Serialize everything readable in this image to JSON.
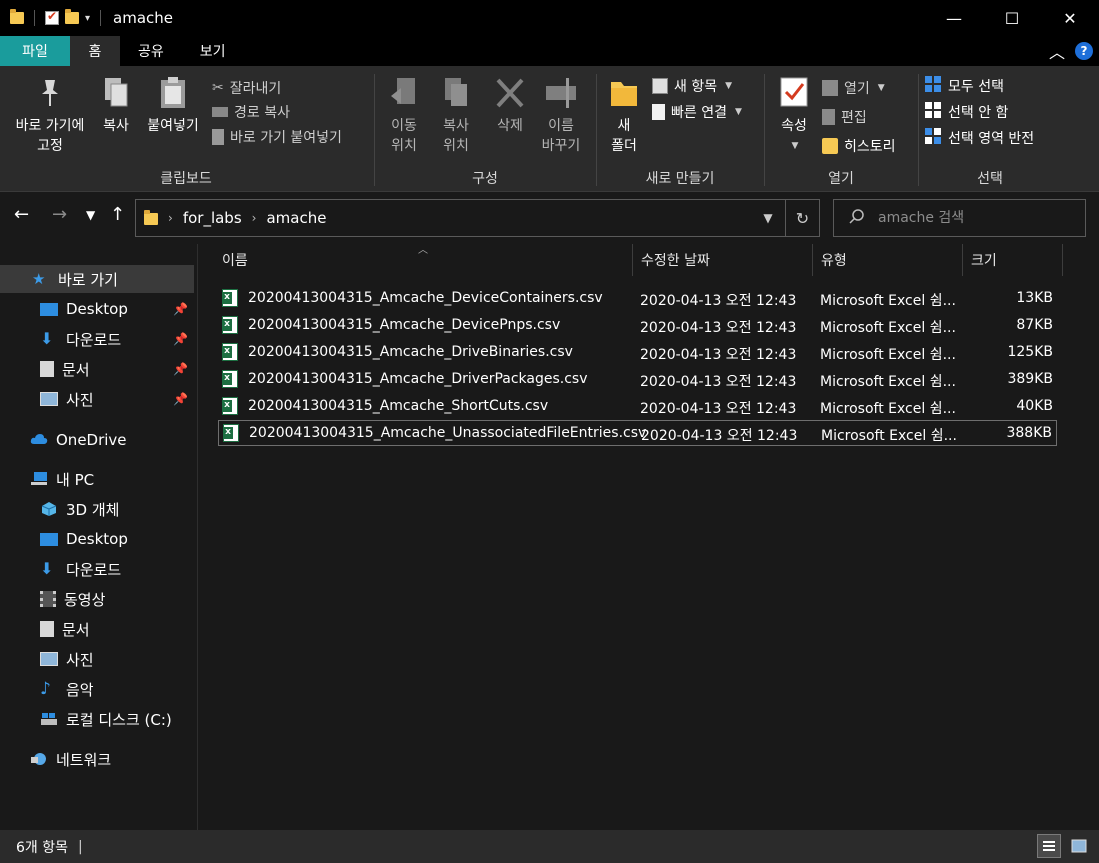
{
  "window": {
    "title": "amache",
    "minimize": "—",
    "maximize": "☐",
    "close": "✕"
  },
  "tabs": [
    "파일",
    "홈",
    "공유",
    "보기"
  ],
  "ribbon": {
    "clipboard": {
      "label": "클립보드",
      "pin_line1": "바로 가기에",
      "pin_line2": "고정",
      "copy": "복사",
      "paste": "붙여넣기",
      "cut": "잘라내기",
      "copy_path": "경로 복사",
      "paste_shortcut": "바로 가기 붙여넣기"
    },
    "organize": {
      "label": "구성",
      "move_line1": "이동",
      "move_line2": "위치",
      "copyto_line1": "복사",
      "copyto_line2": "위치",
      "delete": "삭제",
      "rename_line1": "이름",
      "rename_line2": "바꾸기"
    },
    "new": {
      "label": "새로 만들기",
      "folder_line1": "새",
      "folder_line2": "폴더",
      "new_item": "새 항목",
      "easy_access": "빠른 연결"
    },
    "open": {
      "label": "열기",
      "properties": "속성",
      "open": "열기",
      "edit": "편집",
      "history": "히스토리"
    },
    "select": {
      "label": "선택",
      "select_all": "모두 선택",
      "select_none": "선택 안 함",
      "invert": "선택 영역 반전"
    }
  },
  "address": {
    "path": [
      "for_labs",
      "amache"
    ],
    "search_placeholder": "amache 검색"
  },
  "sidebar": {
    "quick_access": "바로 가기",
    "pinned": [
      "Desktop",
      "다운로드",
      "문서",
      "사진"
    ],
    "onedrive": "OneDrive",
    "this_pc": "내 PC",
    "pc_items": [
      "3D 개체",
      "Desktop",
      "다운로드",
      "동영상",
      "문서",
      "사진",
      "음악",
      "로컬 디스크 (C:)"
    ],
    "network": "네트워크"
  },
  "columns": [
    "이름",
    "수정한 날짜",
    "유형",
    "크기"
  ],
  "files": [
    {
      "name": "20200413004315_Amcache_DeviceContainers.csv",
      "date": "2020-04-13 오전 12:43",
      "type": "Microsoft Excel 쉼...",
      "size": "13KB"
    },
    {
      "name": "20200413004315_Amcache_DevicePnps.csv",
      "date": "2020-04-13 오전 12:43",
      "type": "Microsoft Excel 쉼...",
      "size": "87KB"
    },
    {
      "name": "20200413004315_Amcache_DriveBinaries.csv",
      "date": "2020-04-13 오전 12:43",
      "type": "Microsoft Excel 쉼...",
      "size": "125KB"
    },
    {
      "name": "20200413004315_Amcache_DriverPackages.csv",
      "date": "2020-04-13 오전 12:43",
      "type": "Microsoft Excel 쉼...",
      "size": "389KB"
    },
    {
      "name": "20200413004315_Amcache_ShortCuts.csv",
      "date": "2020-04-13 오전 12:43",
      "type": "Microsoft Excel 쉼...",
      "size": "40KB"
    },
    {
      "name": "20200413004315_Amcache_UnassociatedFileEntries.csv",
      "date": "2020-04-13 오전 12:43",
      "type": "Microsoft Excel 쉼...",
      "size": "388KB"
    }
  ],
  "status": {
    "count": "6개 항목"
  },
  "colors": {
    "file_tab": "#1a9c9c",
    "ribbon_bg": "#2b2b2b",
    "window_bg": "#191919",
    "accent_blue": "#1e6fd9",
    "excel_green": "#1d6f42"
  }
}
